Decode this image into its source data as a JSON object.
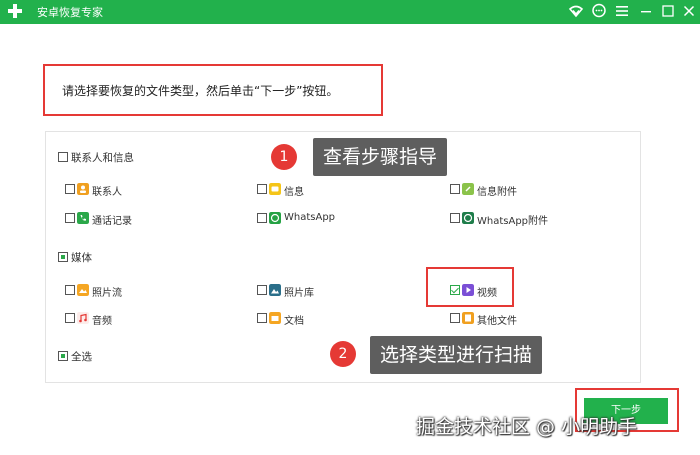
{
  "window": {
    "title": "安卓恢复专家",
    "theme_color": "#22b14c",
    "controls": [
      "wifi-icon",
      "chat-icon",
      "menu-icon",
      "minimize-icon",
      "maximize-icon",
      "close-icon"
    ]
  },
  "instruction": "请选择要恢复的文件类型，然后单击“下一步”按钮。",
  "groups": {
    "contacts": {
      "label": "联系人和信息",
      "checked": false,
      "items": [
        {
          "label": "联系人",
          "icon": "contact-icon",
          "color": "#f0a020",
          "checked": false
        },
        {
          "label": "信息",
          "icon": "message-icon",
          "color": "#f5c518",
          "checked": false
        },
        {
          "label": "信息附件",
          "icon": "attachment-icon",
          "color": "#8bc34a",
          "checked": false
        },
        {
          "label": "通话记录",
          "icon": "call-log-icon",
          "color": "#2ba84a",
          "checked": false
        },
        {
          "label": "WhatsApp",
          "icon": "whatsapp-icon",
          "color": "#25a244",
          "checked": false
        },
        {
          "label": "WhatsApp附件",
          "icon": "whatsapp-attachment-icon",
          "color": "#1e7d4a",
          "checked": false
        }
      ]
    },
    "media": {
      "label": "媒体",
      "checked": true,
      "items": [
        {
          "label": "照片流",
          "icon": "photo-stream-icon",
          "color": "#f5a623",
          "checked": false
        },
        {
          "label": "照片库",
          "icon": "photo-library-icon",
          "color": "#2b6f8a",
          "checked": false
        },
        {
          "label": "视频",
          "icon": "video-icon",
          "color": "#7b4fd6",
          "checked": true
        },
        {
          "label": "音频",
          "icon": "audio-icon",
          "color": "#e53935",
          "checked": false
        },
        {
          "label": "文档",
          "icon": "document-icon",
          "color": "#f5a623",
          "checked": false
        },
        {
          "label": "其他文件",
          "icon": "other-files-icon",
          "color": "#f0a020",
          "checked": false
        }
      ]
    },
    "select_all": {
      "label": "全选",
      "checked": true
    }
  },
  "annotations": {
    "step1": {
      "number": "1",
      "text": "查看步骤指导"
    },
    "step2": {
      "number": "2",
      "text": "选择类型进行扫描"
    }
  },
  "next_button": "下一步",
  "watermark": "掘金技术社区 @ 小明助手"
}
